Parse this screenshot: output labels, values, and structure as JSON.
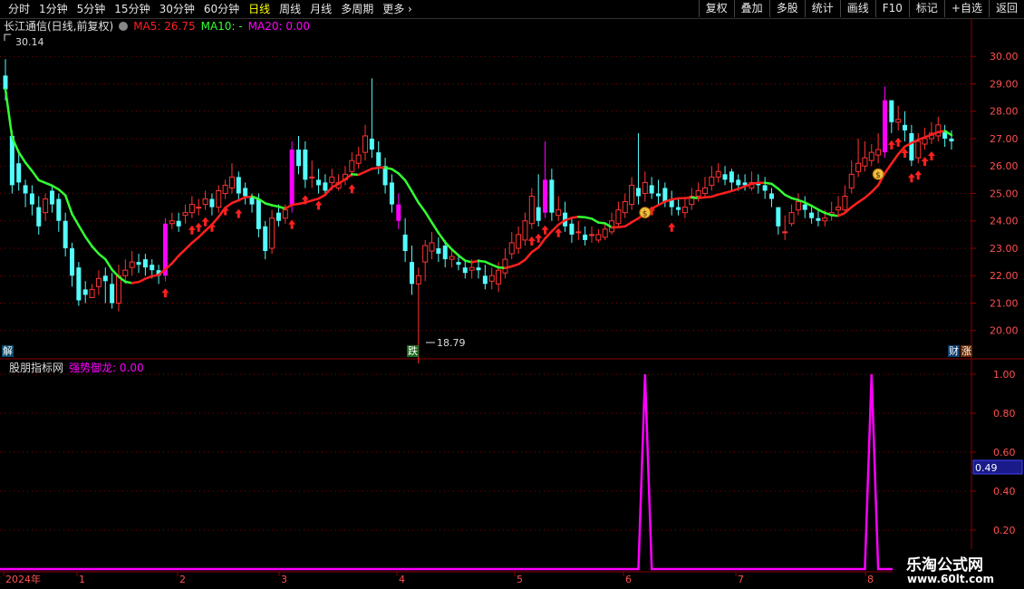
{
  "toolbar": {
    "periods": [
      "分时",
      "1分钟",
      "5分钟",
      "15分钟",
      "30分钟",
      "60分钟",
      "日线",
      "周线",
      "月线",
      "多周期",
      "更多"
    ],
    "active_period": "日线",
    "right_buttons": [
      "复权",
      "叠加",
      "多股",
      "统计",
      "画线",
      "F10",
      "标记",
      "+自选",
      "返回"
    ]
  },
  "main_legend": {
    "title": "长江通信(日线,前复权)",
    "ma5_label": "MA5: 26.75",
    "ma10_label": "MA10: -",
    "ma20_label": "MA20: 0.00"
  },
  "sub_legend": {
    "title": "股朋指标网",
    "indicator_label": "强势御龙: 0.00"
  },
  "badges": {
    "left": "解",
    "mid": "跌",
    "right1": "财",
    "right2": "涨"
  },
  "watermark": {
    "line1": "乐淘公式网",
    "line2": "www.60lt.com"
  },
  "colors": {
    "up": "#ff3333",
    "down": "#54fcfc",
    "limit": "#ff00ff",
    "ma_up": "#ff2020",
    "ma_down": "#33ff33",
    "indicator": "#ff00ff",
    "grid": "#8b0000"
  },
  "chart_data": [
    {
      "type": "candlestick",
      "price_axis": {
        "ticks": [
          "30.00",
          "29.00",
          "28.00",
          "27.00",
          "26.00",
          "25.00",
          "24.00",
          "23.00",
          "22.00",
          "21.00",
          "20.00"
        ],
        "range": [
          19.0,
          30.9
        ]
      },
      "annotations": {
        "high": "30.14",
        "low": "18.79"
      },
      "x_labels": [
        "2024年",
        "1",
        "2",
        "3",
        "4",
        "5",
        "6",
        "7",
        "8"
      ],
      "ohlc_open": [
        29.3,
        27.1,
        26.1,
        25.3,
        25.0,
        24.5,
        24.3,
        25.1,
        24.8,
        24.0,
        23.0,
        22.3,
        21.5,
        21.2,
        21.6,
        22.0,
        21.7,
        21.0,
        22.0,
        22.3,
        22.5,
        22.6,
        22.4,
        22.2,
        22.0,
        23.9,
        24.0,
        24.2,
        24.3,
        24.5,
        24.6,
        24.8,
        24.5,
        25.0,
        25.2,
        25.6,
        25.2,
        24.9,
        24.8,
        23.8,
        23.0,
        24.3,
        24.1,
        24.6,
        26.6,
        26.6,
        25.6,
        25.5,
        25.4,
        25.4,
        25.2,
        25.5,
        25.8,
        26.1,
        26.5,
        27.0,
        26.5,
        26.0,
        25.4,
        24.6,
        23.5,
        22.5,
        21.7,
        22.5,
        22.9,
        23.0,
        23.1,
        22.6,
        22.5,
        22.3,
        22.2,
        22.3,
        22.0,
        21.8,
        21.7,
        22.1,
        22.8,
        23.0,
        23.3,
        23.9,
        24.5,
        24.3,
        25.5,
        24.2,
        24.3,
        23.9,
        23.6,
        23.5,
        23.5,
        23.3,
        23.4,
        23.6,
        23.9,
        24.3,
        24.6,
        25.2,
        25.0,
        25.3,
        25.0,
        25.2,
        24.8,
        24.5,
        24.3,
        24.6,
        24.9,
        25.0,
        25.3,
        25.6,
        25.7,
        25.8,
        25.5,
        25.4,
        25.2,
        25.4,
        25.3,
        25.0,
        24.5,
        23.6,
        23.9,
        24.4,
        24.6,
        24.3,
        24.1,
        24.0,
        24.2,
        24.4,
        24.4,
        25.2,
        25.8,
        26.0,
        26.2,
        26.4,
        26.5,
        28.4,
        27.6,
        27.5,
        27.2,
        26.3,
        26.8,
        27.0,
        27.1,
        27.3,
        27.0
      ],
      "ohlc_close": [
        28.8,
        25.3,
        25.4,
        25.0,
        24.6,
        23.8,
        24.8,
        24.6,
        24.0,
        23.0,
        22.0,
        21.1,
        21.3,
        21.5,
        21.9,
        21.8,
        21.0,
        22.0,
        22.2,
        22.5,
        22.4,
        22.3,
        22.2,
        22.0,
        23.9,
        24.0,
        23.8,
        24.3,
        24.6,
        24.5,
        24.8,
        24.5,
        25.1,
        25.3,
        25.6,
        25.0,
        24.9,
        24.6,
        23.7,
        22.9,
        24.1,
        24.0,
        24.4,
        26.6,
        26.0,
        25.5,
        25.6,
        25.3,
        25.1,
        25.6,
        25.4,
        25.7,
        26.2,
        26.4,
        27.1,
        26.6,
        26.0,
        25.3,
        24.6,
        24.0,
        22.9,
        21.7,
        22.0,
        23.1,
        23.2,
        22.8,
        22.6,
        22.7,
        22.4,
        22.1,
        22.3,
        22.2,
        21.7,
        22.0,
        22.2,
        22.6,
        23.2,
        23.5,
        24.0,
        24.9,
        24.0,
        25.5,
        24.3,
        24.4,
        23.8,
        23.5,
        23.6,
        23.3,
        23.5,
        23.5,
        23.7,
        24.0,
        24.4,
        24.7,
        25.3,
        24.9,
        25.4,
        25.0,
        24.9,
        24.7,
        24.5,
        24.4,
        24.5,
        24.9,
        25.1,
        25.2,
        25.6,
        25.8,
        25.5,
        25.4,
        25.3,
        25.3,
        25.4,
        25.3,
        25.1,
        24.8,
        23.8,
        23.6,
        24.3,
        24.7,
        24.4,
        24.1,
        24.0,
        24.1,
        24.3,
        24.5,
        24.9,
        25.7,
        26.1,
        26.3,
        26.5,
        26.6,
        28.4,
        27.6,
        27.7,
        27.3,
        26.2,
        26.9,
        27.0,
        27.2,
        27.5,
        27.0,
        26.9
      ],
      "ohlc_high": [
        29.9,
        27.3,
        26.5,
        25.5,
        25.3,
        24.9,
        25.0,
        25.3,
        25.0,
        24.3,
        23.2,
        22.5,
        21.8,
        21.7,
        22.2,
        22.3,
        22.1,
        22.4,
        22.6,
        22.9,
        22.8,
        22.8,
        22.6,
        22.4,
        24.1,
        24.3,
        24.3,
        24.6,
        24.9,
        24.8,
        25.1,
        25.0,
        25.3,
        25.5,
        26.1,
        25.8,
        25.4,
        25.0,
        25.0,
        24.0,
        24.4,
        24.6,
        24.6,
        26.9,
        27.1,
        26.9,
        26.2,
        25.9,
        25.7,
        25.9,
        25.7,
        26.0,
        26.5,
        26.7,
        27.5,
        29.2,
        26.9,
        26.3,
        25.7,
        25.0,
        24.1,
        23.1,
        22.3,
        23.3,
        23.6,
        23.4,
        23.3,
        23.0,
        22.8,
        22.6,
        22.6,
        22.6,
        22.4,
        22.3,
        22.5,
        23.0,
        23.6,
        23.8,
        24.3,
        25.2,
        25.7,
        26.9,
        25.9,
        24.9,
        24.7,
        24.1,
        24.0,
        23.8,
        23.8,
        23.7,
        23.9,
        24.3,
        24.7,
        25.0,
        25.6,
        27.2,
        25.8,
        25.6,
        25.5,
        25.4,
        25.1,
        24.8,
        24.8,
        25.2,
        25.4,
        25.6,
        26.0,
        26.1,
        26.0,
        25.9,
        25.7,
        25.7,
        25.8,
        25.7,
        25.6,
        25.2,
        24.3,
        24.2,
        24.6,
        25.0,
        24.9,
        24.5,
        24.4,
        24.4,
        24.7,
        24.9,
        25.3,
        26.2,
        27.0,
        26.9,
        26.8,
        27.2,
        28.9,
        28.4,
        28.2,
        28.0,
        27.5,
        27.2,
        27.4,
        27.6,
        27.8,
        27.5,
        27.3
      ],
      "ohlc_low": [
        28.4,
        25.0,
        25.1,
        24.5,
        24.2,
        23.5,
        24.0,
        24.3,
        23.6,
        22.7,
        21.6,
        20.9,
        21.0,
        21.2,
        21.3,
        21.0,
        20.8,
        20.7,
        21.7,
        22.0,
        22.1,
        22.0,
        21.9,
        21.7,
        21.8,
        23.7,
        23.6,
        23.9,
        24.1,
        24.2,
        24.4,
        24.2,
        24.3,
        24.8,
        25.0,
        24.7,
        24.6,
        24.3,
        23.4,
        22.6,
        22.8,
        23.8,
        23.9,
        24.3,
        25.7,
        25.2,
        25.2,
        25.0,
        24.9,
        25.1,
        25.1,
        25.3,
        25.6,
        25.9,
        26.2,
        26.3,
        25.7,
        25.0,
        24.3,
        23.7,
        22.5,
        21.3,
        18.8,
        21.8,
        22.6,
        22.5,
        22.3,
        22.3,
        22.2,
        21.9,
        21.9,
        21.9,
        21.5,
        21.5,
        21.4,
        21.9,
        22.6,
        22.8,
        23.1,
        23.7,
        23.8,
        24.1,
        24.0,
        24.0,
        23.6,
        23.2,
        23.3,
        23.1,
        23.2,
        23.2,
        23.3,
        23.5,
        23.8,
        24.1,
        24.4,
        24.6,
        24.7,
        24.8,
        24.6,
        24.5,
        24.2,
        24.2,
        24.1,
        24.4,
        24.7,
        24.9,
        25.1,
        25.4,
        25.3,
        25.1,
        25.1,
        25.1,
        25.1,
        25.0,
        24.8,
        24.5,
        23.5,
        23.3,
        23.8,
        24.2,
        24.1,
        23.9,
        23.8,
        23.8,
        24.0,
        24.2,
        24.3,
        25.0,
        25.6,
        25.8,
        26.0,
        26.1,
        26.3,
        27.2,
        27.3,
        26.9,
        26.0,
        26.1,
        26.6,
        26.8,
        26.9,
        26.7,
        26.6
      ],
      "limit_up_indexes": [
        24,
        43,
        59,
        81,
        132
      ],
      "buy_arrow_indexes": [
        24,
        28,
        29,
        30,
        31,
        33,
        35,
        43,
        45,
        47,
        52,
        79,
        80,
        81,
        83,
        96,
        97,
        100,
        133,
        134,
        135,
        136,
        137,
        138,
        139
      ],
      "money_bag_indexes": [
        96,
        131
      ]
    },
    {
      "type": "line",
      "name": "强势御龙",
      "y_ticks": [
        "1.00",
        "0.80",
        "0.60",
        "0.40",
        "0.20"
      ],
      "ylim": [
        0,
        1.0
      ],
      "current_value_label": "0.49",
      "spike_indexes": [
        96,
        130
      ]
    }
  ]
}
